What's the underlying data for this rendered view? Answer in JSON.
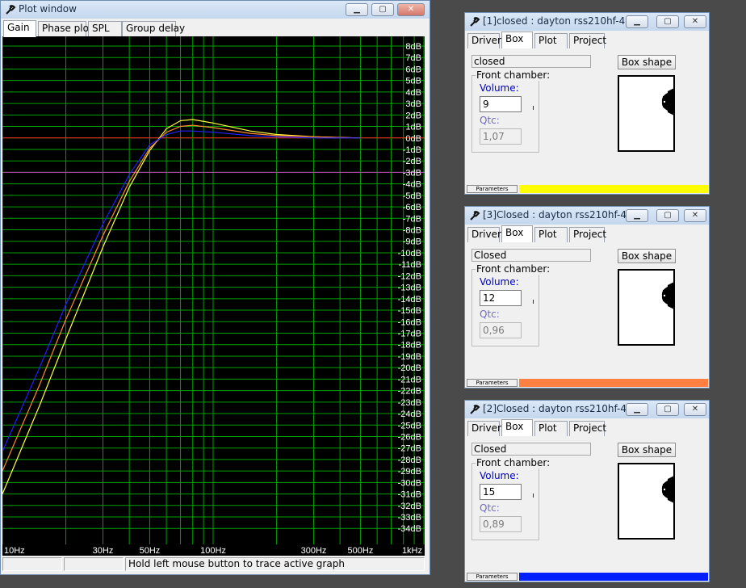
{
  "plot_window": {
    "title": "Plot window",
    "tabs": [
      {
        "label": "Gain",
        "active": true
      },
      {
        "label": "Phase plot",
        "active": false
      },
      {
        "label": "SPL",
        "active": false
      },
      {
        "label": "Group delay",
        "active": false
      }
    ],
    "status": {
      "cell1": "",
      "cell2": "",
      "hint": "Hold left mouse button to trace active graph"
    }
  },
  "chart_data": {
    "type": "line",
    "xscale": "log",
    "xlim": [
      10,
      1000
    ],
    "ylim": [
      -35,
      9
    ],
    "x_ticks": [
      10,
      30,
      50,
      100,
      300,
      500,
      1000
    ],
    "x_tick_labels": [
      "10Hz",
      "30Hz",
      "50Hz",
      "100Hz",
      "300Hz",
      "500Hz",
      "1kHz"
    ],
    "y_ticks": [
      8,
      7,
      6,
      5,
      4,
      3,
      2,
      1,
      0,
      -1,
      -2,
      -3,
      -4,
      -5,
      -6,
      -7,
      -8,
      -9,
      -10,
      -11,
      -12,
      -13,
      -14,
      -15,
      -16,
      -17,
      -18,
      -19,
      -20,
      -21,
      -22,
      -23,
      -24,
      -25,
      -26,
      -27,
      -28,
      -29,
      -30,
      -31,
      -32,
      -33,
      -34
    ],
    "y_tick_labels": [
      "8dB",
      "7dB",
      "6dB",
      "5dB",
      "4dB",
      "3dB",
      "2dB",
      "1dB",
      "0dB",
      "-1dB",
      "-2dB",
      "-3dB",
      "-4dB",
      "-5dB",
      "-6dB",
      "-7dB",
      "-8dB",
      "-9dB",
      "-10dB",
      "-11dB",
      "-12dB",
      "-13dB",
      "-14dB",
      "-15dB",
      "-16dB",
      "-17dB",
      "-18dB",
      "-19dB",
      "-20dB",
      "-21dB",
      "-22dB",
      "-23dB",
      "-24dB",
      "-25dB",
      "-26dB",
      "-27dB",
      "-28dB",
      "-29dB",
      "-30dB",
      "-31dB",
      "-32dB",
      "-33dB",
      "-34dB"
    ],
    "grid": true,
    "reference_lines": [
      {
        "y": 0,
        "color": "#ff2020"
      },
      {
        "y": -3,
        "color": "#c040c0"
      }
    ],
    "series": [
      {
        "color": "#ffff40",
        "x": [
          10,
          15,
          20,
          30,
          40,
          50,
          60,
          70,
          80,
          100,
          150,
          200,
          300,
          500
        ],
        "y": [
          -31.0,
          -23.3,
          -17.5,
          -9.5,
          -4.3,
          -1.1,
          0.8,
          1.5,
          1.6,
          1.3,
          0.6,
          0.3,
          0.1,
          0.0
        ]
      },
      {
        "color": "#ff8a30",
        "x": [
          10,
          15,
          20,
          30,
          40,
          50,
          60,
          70,
          80,
          100,
          150,
          200,
          300,
          500
        ],
        "y": [
          -29.0,
          -21.5,
          -15.8,
          -8.5,
          -3.8,
          -0.9,
          0.5,
          1.0,
          1.1,
          0.9,
          0.4,
          0.2,
          0.1,
          0.0
        ]
      },
      {
        "color": "#2020ff",
        "x": [
          10,
          15,
          20,
          30,
          40,
          50,
          60,
          70,
          80,
          100,
          150,
          200,
          300,
          500
        ],
        "y": [
          -27.3,
          -20.0,
          -14.5,
          -7.5,
          -3.2,
          -0.6,
          0.3,
          0.6,
          0.6,
          0.5,
          0.2,
          0.1,
          0.0,
          0.0
        ]
      }
    ]
  },
  "box_windows": [
    {
      "title": "[1]closed : dayton rss210hf-4",
      "tabs": [
        {
          "label": "Driver",
          "active": false
        },
        {
          "label": "Box",
          "active": true
        },
        {
          "label": "Plot",
          "active": false
        },
        {
          "label": "Project",
          "active": false
        }
      ],
      "name": "closed",
      "box_shape_label": "Box shape",
      "front_chamber_label": "Front chamber:",
      "volume_label": "Volume:",
      "volume": "9",
      "qtc_label": "Qtc:",
      "qtc": "1,07",
      "params_label": "Parameters",
      "color": "#ffff00"
    },
    {
      "title": "[3]Closed : dayton rss210hf-4",
      "tabs": [
        {
          "label": "Driver",
          "active": false
        },
        {
          "label": "Box",
          "active": true
        },
        {
          "label": "Plot",
          "active": false
        },
        {
          "label": "Project",
          "active": false
        }
      ],
      "name": "Closed",
      "box_shape_label": "Box shape",
      "front_chamber_label": "Front chamber:",
      "volume_label": "Volume:",
      "volume": "12",
      "qtc_label": "Qtc:",
      "qtc": "0,96",
      "params_label": "Parameters",
      "color": "#ff8040"
    },
    {
      "title": "[2]Closed : dayton rss210hf-4",
      "tabs": [
        {
          "label": "Driver",
          "active": false
        },
        {
          "label": "Box",
          "active": true
        },
        {
          "label": "Plot",
          "active": false
        },
        {
          "label": "Project",
          "active": false
        }
      ],
      "name": "Closed",
      "box_shape_label": "Box shape",
      "front_chamber_label": "Front chamber:",
      "volume_label": "Volume:",
      "volume": "15",
      "qtc_label": "Qtc:",
      "qtc": "0,89",
      "params_label": "Parameters",
      "color": "#0020ff"
    }
  ]
}
